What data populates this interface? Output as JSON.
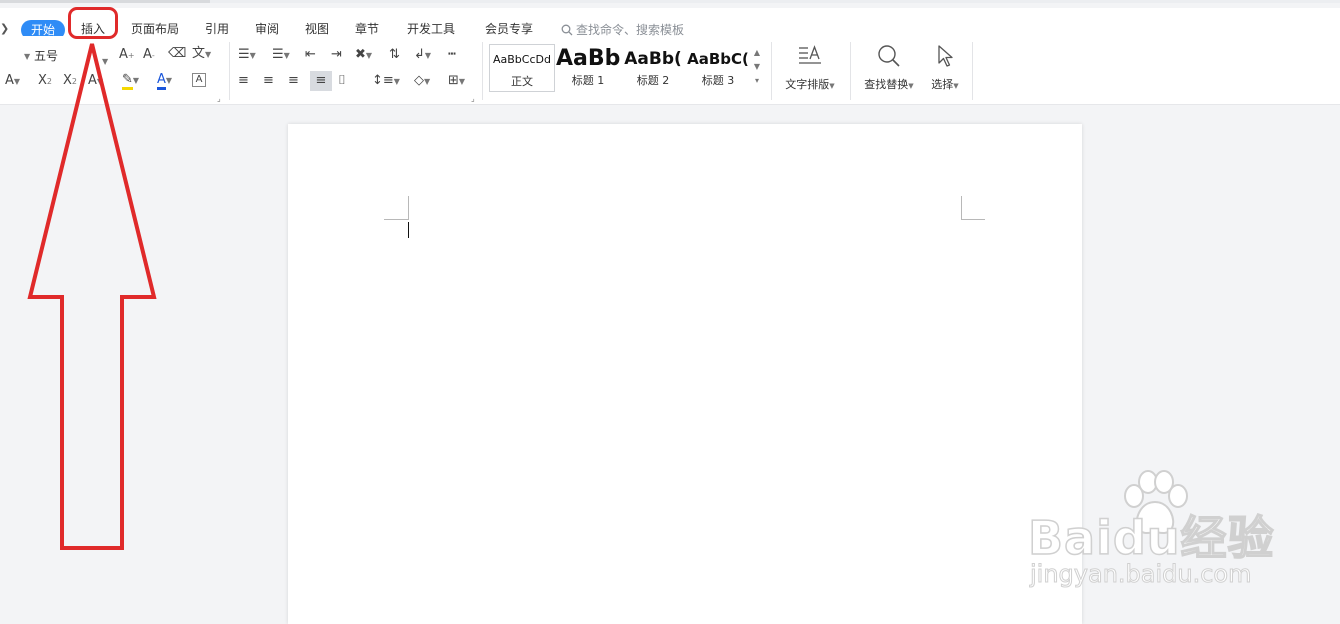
{
  "tabs": {
    "active": "开始",
    "insert": "插入",
    "page_layout": "页面布局",
    "references": "引用",
    "review": "审阅",
    "view": "视图",
    "chapter": "章节",
    "developer": "开发工具",
    "member": "会员专享"
  },
  "search": {
    "placeholder": "查找命令、搜索模板"
  },
  "ribbon": {
    "font_size": "五号",
    "styles": [
      {
        "sample": "AaBbCcDd",
        "label": "正文"
      },
      {
        "sample": "AaBb",
        "label": "标题 1"
      },
      {
        "sample": "AaBb(",
        "label": "标题 2"
      },
      {
        "sample": "AaBbC(",
        "label": "标题 3"
      }
    ],
    "text_layout": "文字排版",
    "find_replace": "查找替换",
    "select": "选择"
  },
  "watermark": {
    "brand_text": "Baidu经验",
    "url": "jingyan.baidu.com"
  },
  "colors": {
    "accent": "#2f8cf6",
    "annotation_red": "#e02a2a",
    "highlight_yellow": "#f5d800",
    "font_color_blue": "#1a56db"
  }
}
